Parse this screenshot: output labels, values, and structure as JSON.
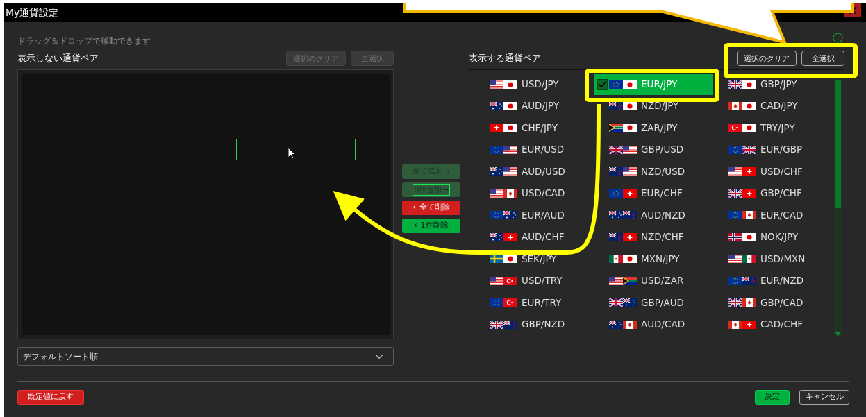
{
  "window": {
    "title": "My通貨設定"
  },
  "hint": "ドラッグ＆ドロップで移動できます",
  "hidden_pairs": {
    "title": "表示しない通貨ペア",
    "buttons": [
      {
        "label": "選択のクリア",
        "disabled": true
      },
      {
        "label": "全選択",
        "disabled": true
      }
    ]
  },
  "transfer_buttons": [
    {
      "label": "全て追加→",
      "kind": "add_all",
      "disabled": true,
      "focused": false
    },
    {
      "label": "0件追加→",
      "kind": "add_one",
      "disabled": true,
      "focused": true
    },
    {
      "label": "←全て削除",
      "kind": "remove_all",
      "disabled": false,
      "focused": false
    },
    {
      "label": "←1件削除",
      "kind": "remove_one",
      "disabled": false,
      "focused": false
    }
  ],
  "shown_pairs": {
    "title": "表示する通貨ペア",
    "buttons": [
      {
        "label": "選択のクリア",
        "disabled": false
      },
      {
        "label": "全選択",
        "disabled": false
      }
    ],
    "pairs": [
      {
        "label": "USD/JPY",
        "selected": false
      },
      {
        "label": "EUR/JPY",
        "selected": true
      },
      {
        "label": "GBP/JPY",
        "selected": false
      },
      {
        "label": "AUD/JPY",
        "selected": false
      },
      {
        "label": "NZD/JPY",
        "selected": false
      },
      {
        "label": "CAD/JPY",
        "selected": false
      },
      {
        "label": "CHF/JPY",
        "selected": false
      },
      {
        "label": "ZAR/JPY",
        "selected": false
      },
      {
        "label": "TRY/JPY",
        "selected": false
      },
      {
        "label": "EUR/USD",
        "selected": false
      },
      {
        "label": "GBP/USD",
        "selected": false
      },
      {
        "label": "EUR/GBP",
        "selected": false
      },
      {
        "label": "AUD/USD",
        "selected": false
      },
      {
        "label": "NZD/USD",
        "selected": false
      },
      {
        "label": "USD/CHF",
        "selected": false
      },
      {
        "label": "USD/CAD",
        "selected": false
      },
      {
        "label": "EUR/CHF",
        "selected": false
      },
      {
        "label": "GBP/CHF",
        "selected": false
      },
      {
        "label": "EUR/AUD",
        "selected": false
      },
      {
        "label": "AUD/NZD",
        "selected": false
      },
      {
        "label": "EUR/CAD",
        "selected": false
      },
      {
        "label": "AUD/CHF",
        "selected": false
      },
      {
        "label": "NZD/CHF",
        "selected": false
      },
      {
        "label": "NOK/JPY",
        "selected": false
      },
      {
        "label": "SEK/JPY",
        "selected": false
      },
      {
        "label": "MXN/JPY",
        "selected": false
      },
      {
        "label": "USD/MXN",
        "selected": false
      },
      {
        "label": "USD/TRY",
        "selected": false
      },
      {
        "label": "USD/ZAR",
        "selected": false
      },
      {
        "label": "EUR/NZD",
        "selected": false
      },
      {
        "label": "EUR/TRY",
        "selected": false
      },
      {
        "label": "GBP/AUD",
        "selected": false
      },
      {
        "label": "GBP/CAD",
        "selected": false
      },
      {
        "label": "GBP/NZD",
        "selected": false
      },
      {
        "label": "AUD/CAD",
        "selected": false
      },
      {
        "label": "CAD/CHF",
        "selected": false
      }
    ]
  },
  "sort": {
    "value": "デフォルトソート順"
  },
  "footer": {
    "reset_button": "既定値に戻す",
    "ok_button": "決定",
    "cancel_button": "キャンセル"
  }
}
